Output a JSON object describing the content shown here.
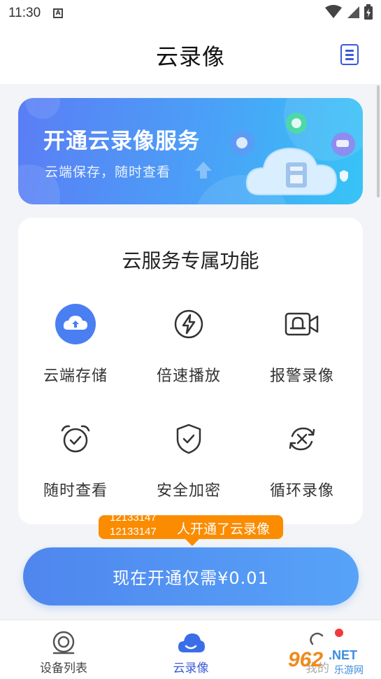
{
  "status_bar": {
    "time": "11:30",
    "a_icon": "A"
  },
  "header": {
    "title": "云录像",
    "menu_icon": "list-icon"
  },
  "banner": {
    "title": "开通云录像服务",
    "subtitle": "云端保存，随时查看"
  },
  "features_card": {
    "title": "云服务专属功能",
    "items": [
      {
        "label": "云端存储",
        "icon": "cloud-upload-icon"
      },
      {
        "label": "倍速播放",
        "icon": "lightning-icon"
      },
      {
        "label": "报警录像",
        "icon": "alarm-camera-icon"
      },
      {
        "label": "随时查看",
        "icon": "alarm-clock-icon"
      },
      {
        "label": "安全加密",
        "icon": "shield-check-icon"
      },
      {
        "label": "循环录像",
        "icon": "loop-icon"
      }
    ]
  },
  "tooltip": {
    "count_top": "12133147",
    "count_bottom": "12133147",
    "message": "人开通了云录像"
  },
  "cta": {
    "label": "现在开通仅需¥0.01"
  },
  "tabbar": {
    "items": [
      {
        "label": "设备列表",
        "icon": "device-list-icon"
      },
      {
        "label": "云录像",
        "icon": "cloud-icon"
      },
      {
        "label": "我的",
        "icon": "profile-icon"
      }
    ]
  },
  "watermark": {
    "text": "962.NET",
    "sub": "乐游网"
  },
  "colors": {
    "accent": "#3a5ad8",
    "banner_start": "#5b7df5",
    "banner_end": "#37c4f6",
    "tooltip": "#fb8c00",
    "cta_start": "#4f86ee",
    "cta_end": "#57a3f8",
    "badge": "#ef3b3b"
  }
}
